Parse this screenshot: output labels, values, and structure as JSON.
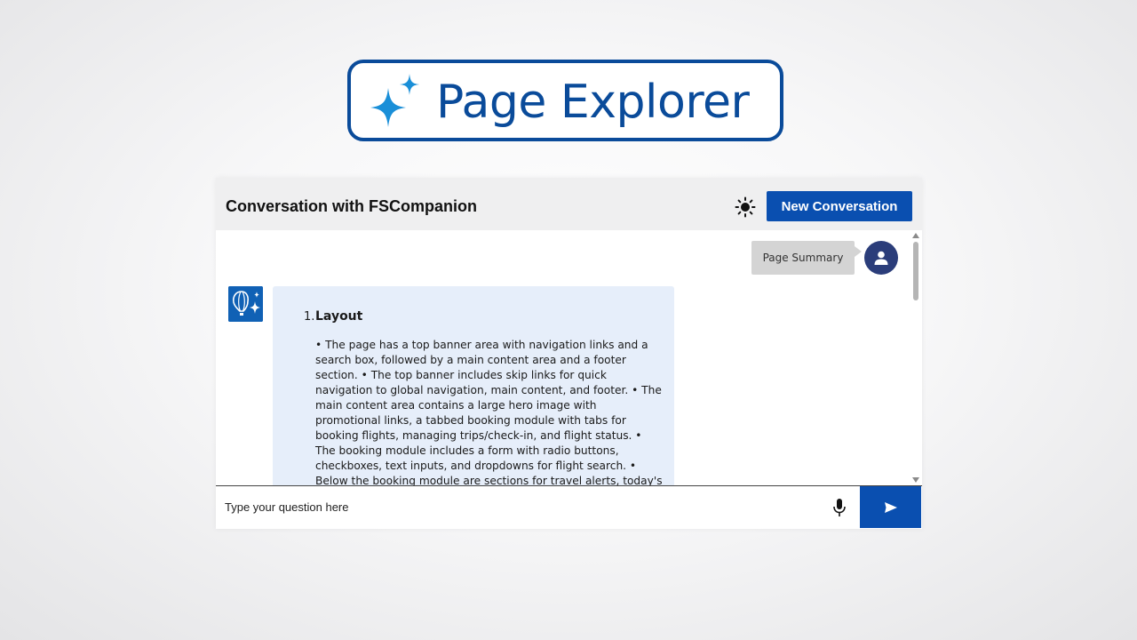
{
  "banner": {
    "title": "Page Explorer",
    "icon": "sparkle-icon"
  },
  "chat": {
    "title": "Conversation with FSCompanion",
    "theme_icon": "sun-icon",
    "new_conversation_label": "New Conversation",
    "messages": [
      {
        "role": "user",
        "text": "Page Summary",
        "avatar_icon": "user-icon"
      },
      {
        "role": "assistant",
        "avatar_icon": "balloon-sparkle-logo",
        "section_number": "1.",
        "section_title": "Layout",
        "section_body": "• The page has a top banner area with navigation links and a search box, followed by a main content area and a footer section. • The top banner includes skip links for quick navigation to global navigation, main content, and footer. • The main content area contains a large hero image with promotional links, a tabbed booking module with tabs for booking flights, managing trips/check-in, and flight status. • The booking module includes a form with radio buttons, checkboxes, text inputs, and dropdowns for flight search. • Below the booking module are sections for travel alerts, today's offers and news and offers. • The footer area contains multiple columns of helpful links."
      }
    ],
    "input": {
      "placeholder": "Type your question here",
      "value": ""
    },
    "icons": {
      "mic": "microphone-icon",
      "send": "send-icon",
      "scroll": "chevron-down-icon"
    }
  },
  "colors": {
    "brand": "#0a4b9a",
    "button": "#0a4fb0",
    "assistant_bubble": "#e6eefa",
    "user_bubble": "#d4d4d4",
    "user_avatar": "#2b3d7a"
  }
}
